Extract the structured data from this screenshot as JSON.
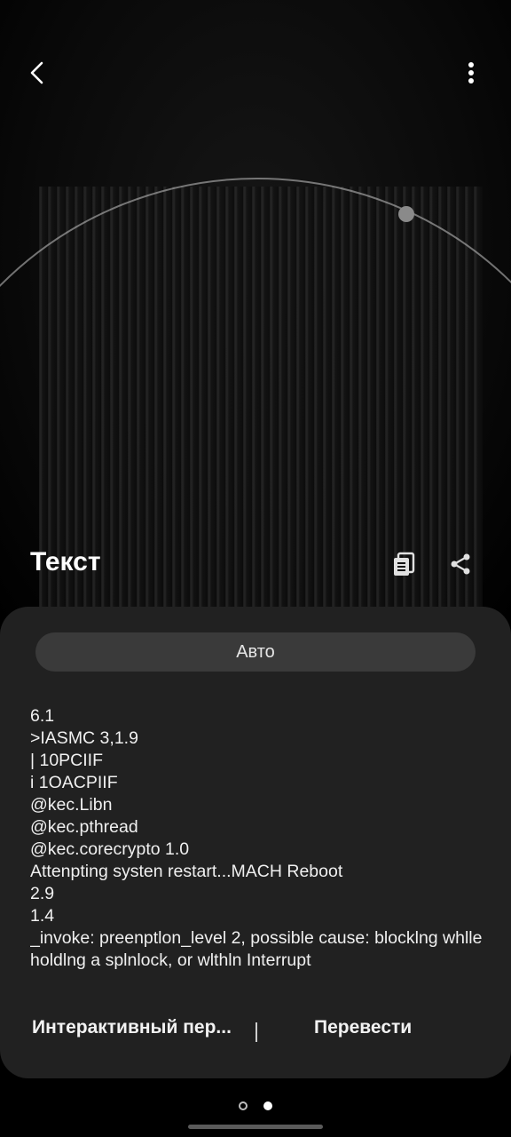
{
  "header": {
    "back_icon": "chevron-left-icon",
    "more_icon": "vertical-dots-icon"
  },
  "panel": {
    "title": "Текст",
    "copy_icon": "copy-text-icon",
    "share_icon": "share-icon"
  },
  "sheet": {
    "language_mode": "Авто",
    "ocr_lines": [
      "6.1",
      ">IASMC 3,1.9",
      "| 10PCIIF",
      "i 1OACPIIF",
      "@kec.Libn",
      "@kec.pthread",
      "@kec.corecrypto 1.0",
      "Attenpting systen restart...MACH Reboot",
      "2.9",
      "1.4",
      "_invoke: preenptlon_level 2, possible cause: blocklng whlle holdlng a splnlock, or wlthln Interrupt"
    ],
    "actions": {
      "interactive": "Интерактивный пер...",
      "translate": "Перевести"
    }
  },
  "pager": {
    "count": 2,
    "active_index": 1
  },
  "colors": {
    "sheet_bg": "#212121",
    "pill_bg": "#3a3a3a"
  }
}
